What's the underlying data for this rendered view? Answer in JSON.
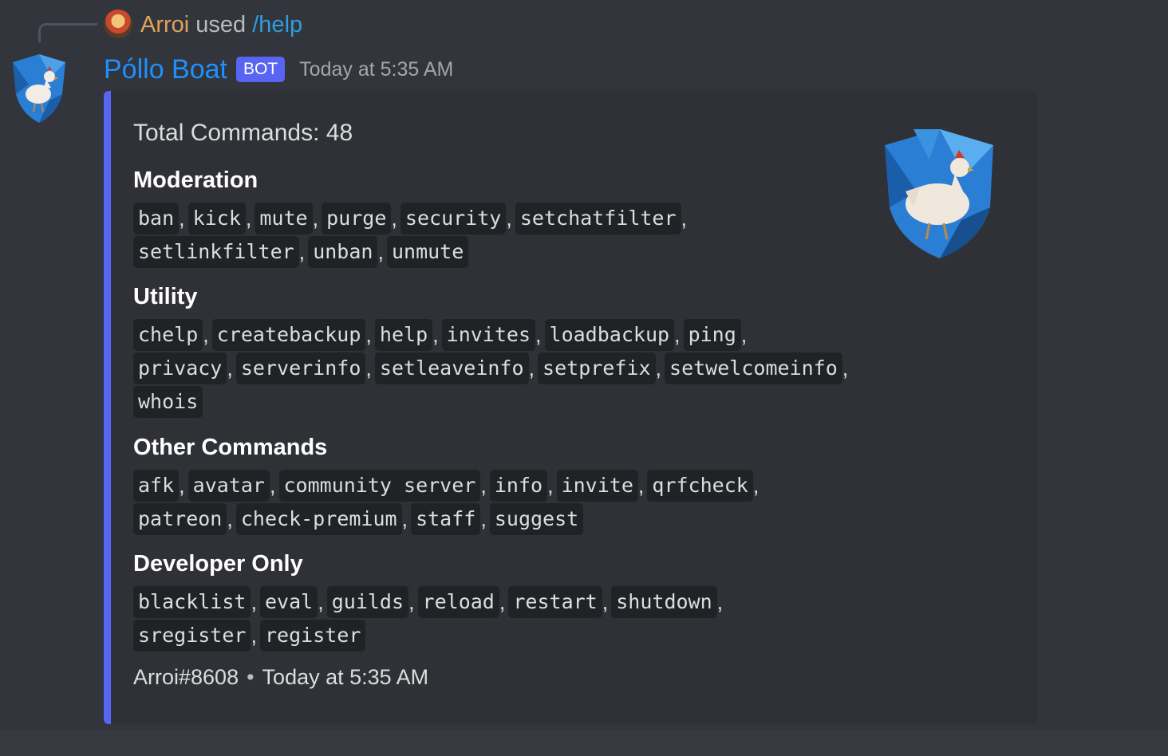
{
  "reply": {
    "user": "Arroi",
    "used": "used",
    "command": "/help"
  },
  "message": {
    "author": "Póllo Boat",
    "tag": "BOT",
    "timestamp": "Today at 5:35 AM"
  },
  "embed": {
    "description": "Total Commands: 48",
    "accent_color": "#5865f2",
    "categories": [
      {
        "title": "Moderation",
        "lines": [
          [
            "ban",
            "kick",
            "mute",
            "purge",
            "security",
            "setchatfilter"
          ],
          [
            "setlinkfilter",
            "unban",
            "unmute"
          ]
        ]
      },
      {
        "title": "Utility",
        "lines": [
          [
            "chelp",
            "createbackup",
            "help",
            "invites",
            "loadbackup",
            "ping"
          ],
          [
            "privacy",
            "serverinfo",
            "setleaveinfo",
            "setprefix",
            "setwelcomeinfo"
          ],
          [
            "whois"
          ]
        ]
      },
      {
        "title": "Other Commands",
        "lines": [
          [
            "afk",
            "avatar",
            "community server",
            "info",
            "invite",
            "qrfcheck"
          ],
          [
            "patreon",
            "check-premium",
            "staff",
            "suggest"
          ]
        ]
      },
      {
        "title": "Developer Only",
        "lines": [
          [
            "blacklist",
            "eval",
            "guilds",
            "reload",
            "restart",
            "shutdown"
          ],
          [
            "sregister",
            "register"
          ]
        ]
      }
    ],
    "footer": {
      "author": "Arroi#8608",
      "separator": "•",
      "time": "Today at 5:35 AM"
    }
  },
  "icons": {
    "bot_avatar": "chicken-shield-icon",
    "thumbnail": "chicken-shield-icon",
    "reply_avatar": "user-avatar"
  }
}
